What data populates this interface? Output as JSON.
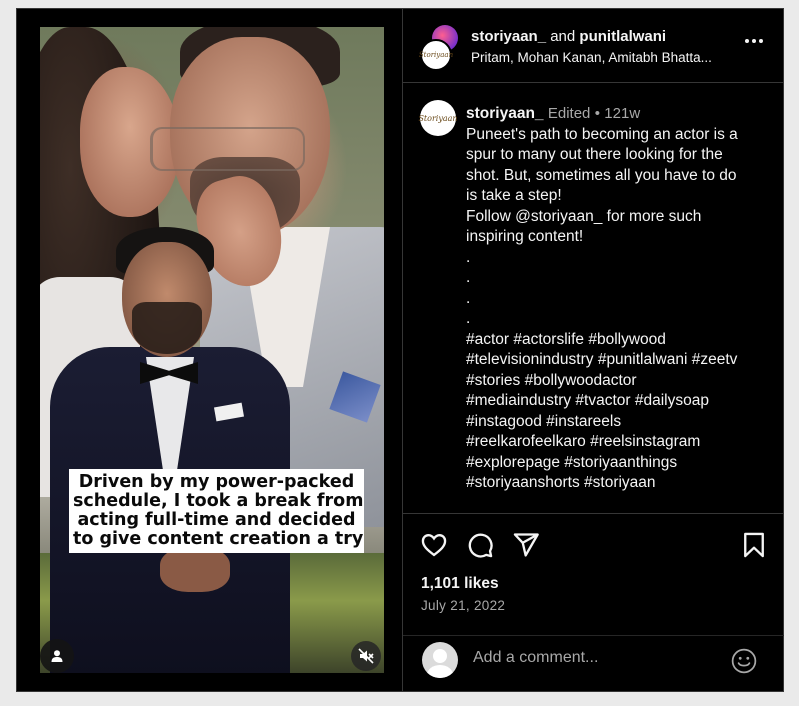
{
  "post": {
    "caption_overlay": [
      "Driven by my power-packed",
      "schedule, I took a break from",
      "acting full-time and decided",
      "to give content creation a try"
    ]
  },
  "header": {
    "user1": "storiyaan_",
    "and_text": "and",
    "user2": "punitlalwani",
    "audio": "Pritam, Mohan Kanan, Amitabh Bhatta...",
    "avatar_text": "Storiyaan"
  },
  "comment": {
    "username": "storiyaan_",
    "edited": "Edited",
    "dot": "•",
    "age": "121w",
    "lines": [
      "Puneet's path to becoming an actor is a",
      "spur to many out there looking for the",
      "shot. But, sometimes all you have to do",
      "is take a step!",
      "Follow @storiyaan_ for more such",
      "inspiring content!",
      ".",
      ".",
      ".",
      ".",
      "#actor #actorslife #bollywood",
      "#televisionindustry #punitlalwani #zeetv",
      "#stories #bollywoodactor",
      "#mediaindustry #tvactor #dailysoap",
      "#instagood #instareels",
      "#reelkarofeelkaro #reelsinstagram",
      "#explorepage #storiyaanthings",
      "#storiyaanshorts #storiyaan"
    ]
  },
  "stats": {
    "likes": "1,101 likes",
    "date": "July 21, 2022"
  },
  "add_comment": {
    "placeholder": "Add a comment..."
  },
  "icons": {
    "like": "heart-icon",
    "comment": "comment-icon",
    "share": "send-icon",
    "save": "bookmark-icon",
    "more": "more-icon",
    "mute": "muted-speaker-icon",
    "tag": "user-tag-icon",
    "emoji": "emoji-icon"
  }
}
